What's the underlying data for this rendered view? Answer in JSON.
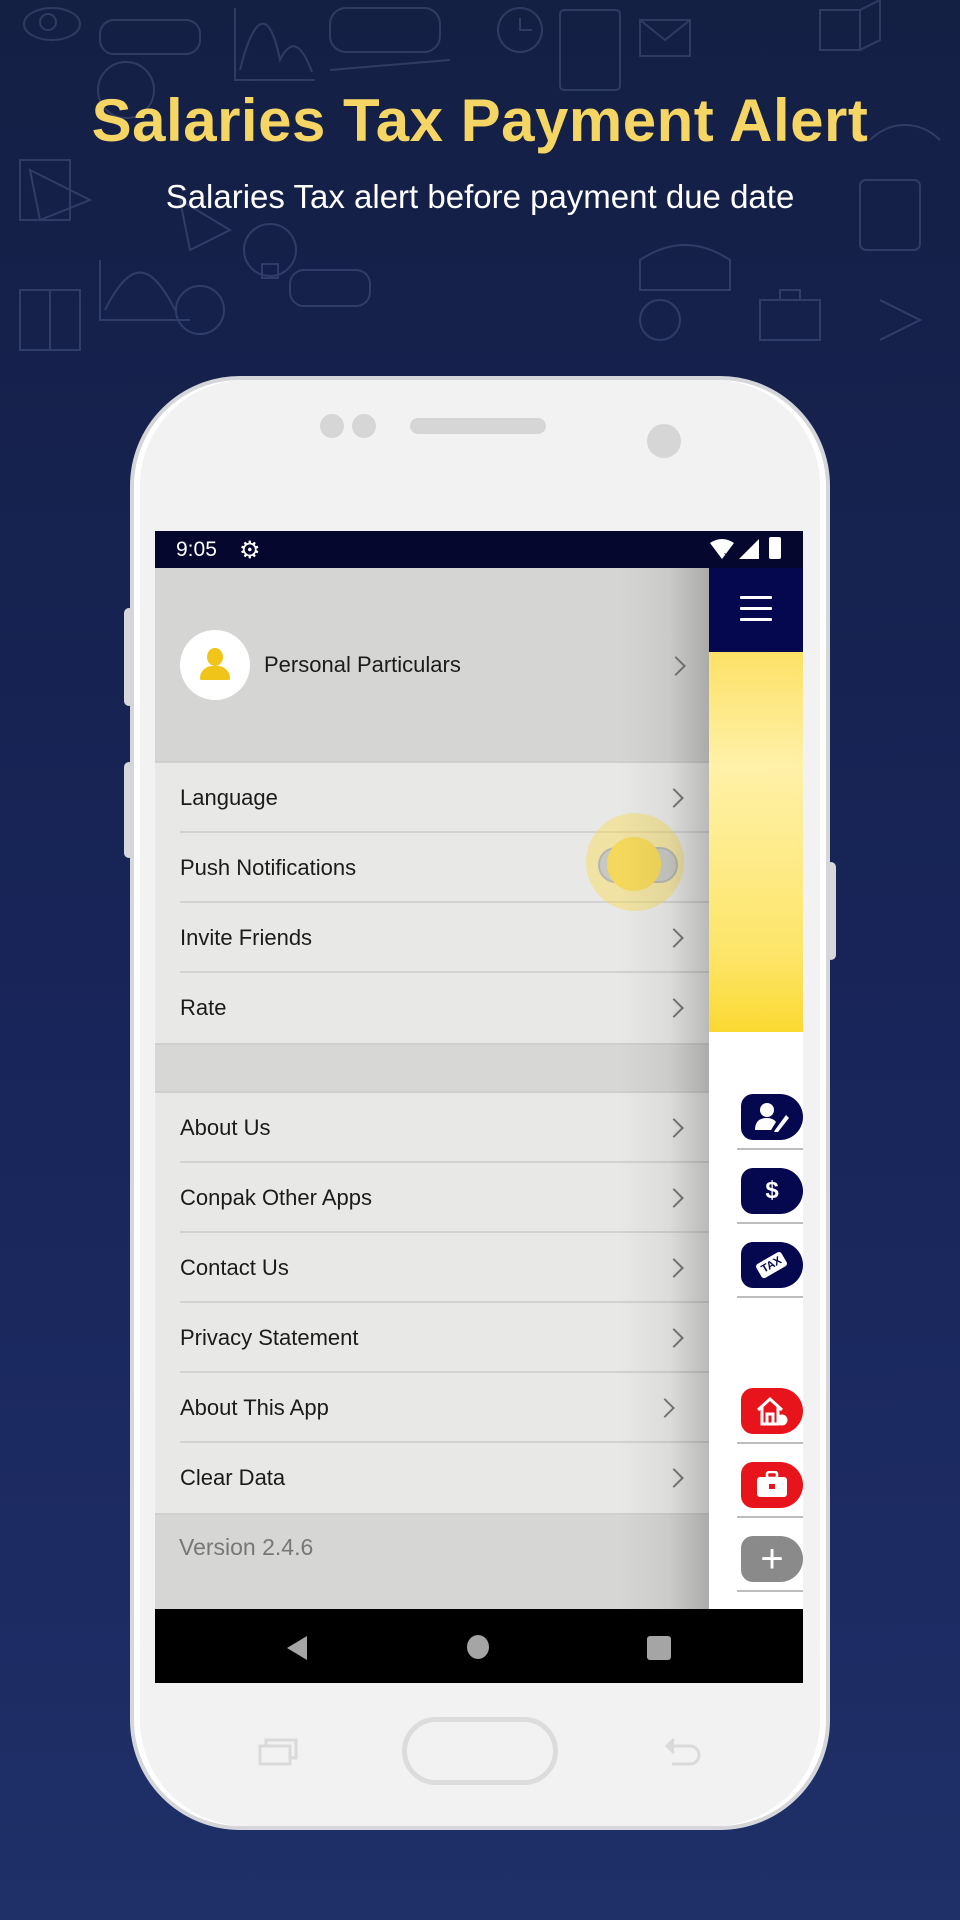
{
  "promo": {
    "title": "Salaries Tax Payment Alert",
    "subtitle": "Salaries Tax alert before payment due date"
  },
  "statusbar": {
    "time": "9:05",
    "icons": [
      "gear-icon",
      "wifi-off-icon",
      "signal-icon",
      "battery-charging-icon"
    ]
  },
  "drawer": {
    "profile": {
      "label": "Personal Particulars",
      "icon": "user-icon"
    },
    "group1": [
      {
        "label": "Language",
        "type": "link"
      },
      {
        "label": "Push Notifications",
        "type": "toggle",
        "on": true
      },
      {
        "label": "Invite Friends",
        "type": "link"
      },
      {
        "label": "Rate",
        "type": "link"
      }
    ],
    "group2": [
      {
        "label": "About Us"
      },
      {
        "label": "Conpak Other Apps"
      },
      {
        "label": "Contact Us"
      },
      {
        "label": "Privacy Statement"
      },
      {
        "label": "About This App"
      },
      {
        "label": "Clear Data"
      }
    ],
    "version": "Version 2.4.6"
  },
  "app_side": {
    "icons": [
      {
        "name": "edit-profile-icon",
        "color": "#05074f"
      },
      {
        "name": "dollar-icon",
        "color": "#05074f",
        "glyph": "$"
      },
      {
        "name": "tax-tag-icon",
        "color": "#05074f",
        "glyph": "TAX"
      },
      {
        "name": "home-add-icon",
        "color": "#e8141c"
      },
      {
        "name": "briefcase-icon",
        "color": "#e8141c"
      },
      {
        "name": "plus-icon",
        "color": "#8a8a8a",
        "glyph": "+"
      }
    ]
  },
  "colors": {
    "accent_yellow": "#f5d563",
    "navy": "#05074f",
    "red": "#e8141c",
    "toggle": "#f3d85b"
  }
}
